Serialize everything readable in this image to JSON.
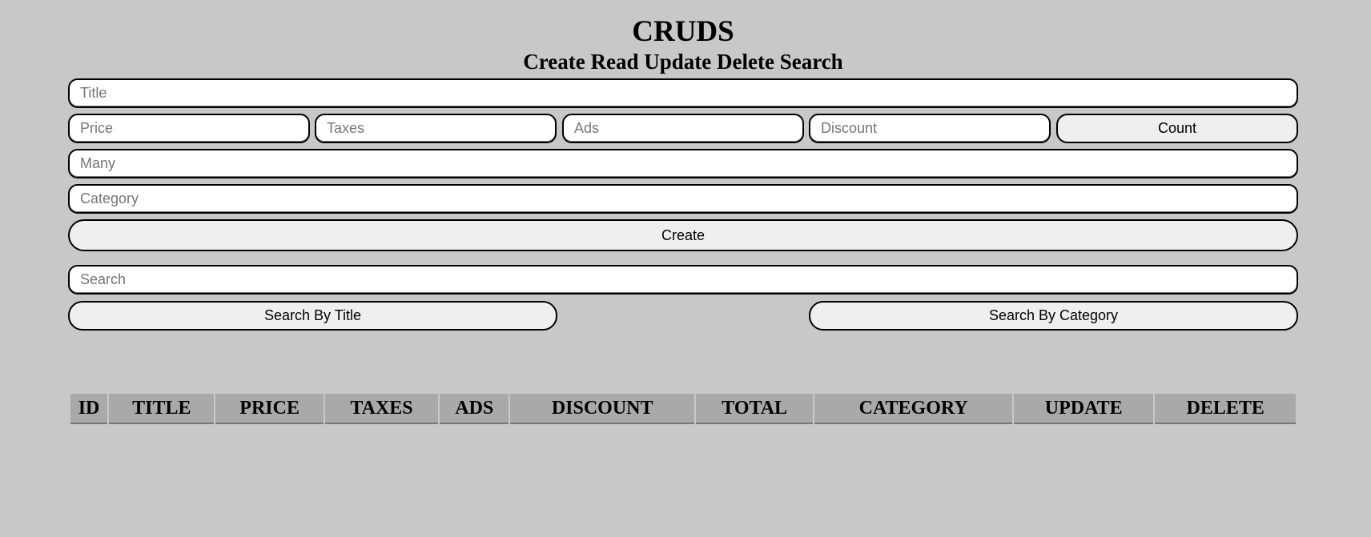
{
  "header": {
    "title": "CRUDS",
    "subtitle": "Create Read Update Delete Search"
  },
  "form": {
    "title_placeholder": "Title",
    "price_placeholder": "Price",
    "taxes_placeholder": "Taxes",
    "ads_placeholder": "Ads",
    "discount_placeholder": "Discount",
    "count_label": "Count",
    "many_placeholder": "Many",
    "category_placeholder": "Category",
    "create_label": "Create"
  },
  "search": {
    "placeholder": "Search",
    "by_title_label": "Search By Title",
    "by_category_label": "Search By Category"
  },
  "table": {
    "headers": [
      "ID",
      "TITLE",
      "PRICE",
      "TAXES",
      "ADS",
      "DISCOUNT",
      "TOTAL",
      "CATEGORY",
      "UPDATE",
      "DELETE"
    ],
    "rows": []
  }
}
